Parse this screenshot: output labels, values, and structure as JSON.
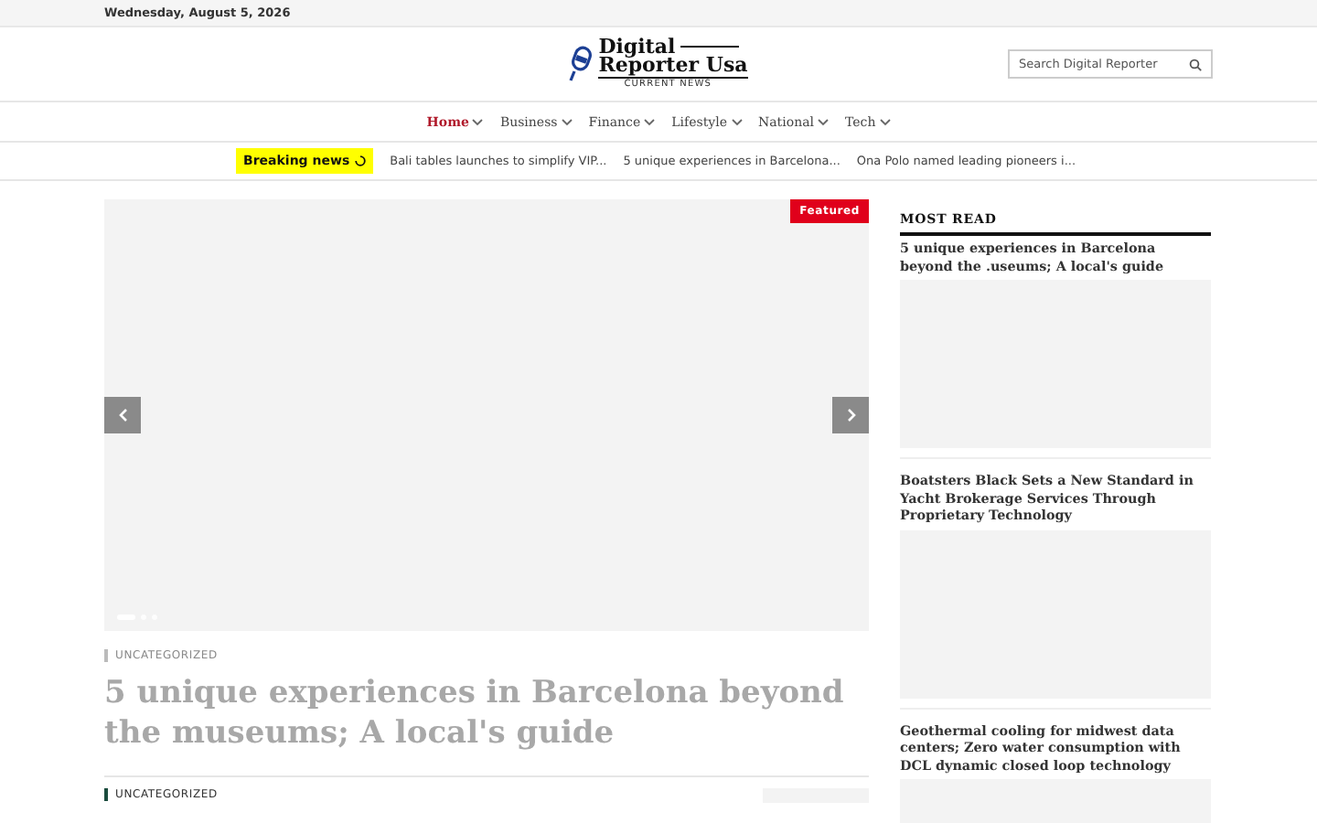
{
  "top_bar": {
    "date": "Wednesday, August 5, 2026"
  },
  "logo": {
    "line_1": "Digital",
    "line_2": "Reporter Usa",
    "tagline": "CURRENT NEWS"
  },
  "search": {
    "placeholder": "Search Digital Reporter"
  },
  "nav": [
    {
      "label": "Home",
      "selected": true
    },
    {
      "label": "Business",
      "selected": false
    },
    {
      "label": "Finance",
      "selected": false
    },
    {
      "label": "Lifestyle",
      "selected": false
    },
    {
      "label": "National",
      "selected": false
    },
    {
      "label": "Tech",
      "selected": false
    }
  ],
  "breaking": {
    "label": "Breaking news",
    "items": [
      "Bali tables launches to simplify VIP...",
      "5 unique experiences in Barcelona...",
      "Ona Polo named leading pioneers i..."
    ]
  },
  "slider": {
    "badge": "Featured",
    "dots": [
      {
        "selected": true
      },
      {
        "selected": false
      },
      {
        "selected": false
      }
    ],
    "category": "UNCATEGORIZED",
    "title": "5 unique experiences in Barcelona beyond the museums; A local's guide"
  },
  "next_article": {
    "category": "UNCATEGORIZED"
  },
  "most_read": {
    "heading": "MOST READ",
    "items": [
      "5 unique experiences in Barcelona beyond the .useums; A local's guide",
      "Boatsters Black Sets a New Standard in Yacht Brokerage Services Through Proprietary Technology",
      "Geothermal cooling for midwest data centers; Zero water consumption with DCL dynamic closed loop technology"
    ]
  }
}
